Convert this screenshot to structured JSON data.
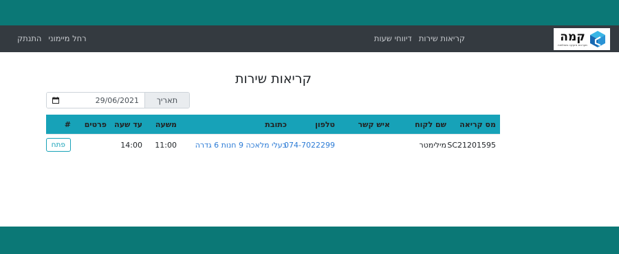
{
  "brand": {
    "name": "קמה",
    "tagline": "מערכות אזעקה ומצלמות",
    "colors": {
      "cube_light": "#39b6e6",
      "cube_dark": "#1769b3"
    }
  },
  "nav": {
    "links": [
      "קריאות שירות",
      "דיווחי שעות"
    ],
    "user_name": "רחל מיימוני",
    "logout": "התנתק"
  },
  "page": {
    "title": "קריאות שירות",
    "date_label": "תאריך",
    "date_value": "29/06/2021"
  },
  "table": {
    "headers": [
      "מס קריאה",
      "שם לקוח",
      "איש קשר",
      "טלפון",
      "כתובת",
      "משעה",
      "עד שעה",
      "פרטים",
      "#"
    ],
    "rows": [
      {
        "call_number": "SC21201595",
        "customer": "מילימטר",
        "contact": "",
        "phone": "074-7022299",
        "address": "בעלי מלאכה 9 חנות 6 גדרה",
        "from_time": "11:00",
        "to_time": "14:00",
        "details": "",
        "action": "פתח"
      }
    ]
  },
  "colors": {
    "outer_bg": "#0b7876",
    "navbar": "#343a40",
    "table_header": "#17a2b8",
    "link": "#2b7bd6"
  }
}
